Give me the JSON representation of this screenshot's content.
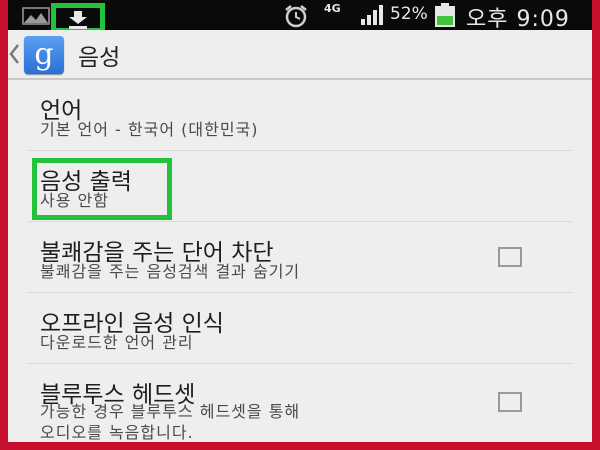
{
  "status_bar": {
    "network": "4G",
    "battery": "52%",
    "time": "오후 9:09",
    "icons": [
      "picture-icon",
      "download-icon",
      "alarm-icon",
      "signal-icon",
      "battery-icon"
    ]
  },
  "action_bar": {
    "back_icon": "chevron-left-icon",
    "app_icon_letter": "g",
    "title": "음성"
  },
  "settings": [
    {
      "title": "언어",
      "subtitle": "기본 언어 - 한국어 (대한민국)"
    },
    {
      "title": "음성 출력",
      "subtitle": "사용 안함"
    },
    {
      "title": "불쾌감을 주는 단어 차단",
      "subtitle": "불쾌감을 주는 음성검색 결과 숨기기",
      "checked": false
    },
    {
      "title": "오프라인 음성 인식",
      "subtitle": "다운로드한 언어 관리"
    },
    {
      "title": "블루투스 헤드셋",
      "subtitle_lines": [
        "가능한 경우 블루투스 헤드셋을 통해",
        "오디오를 녹음합니다."
      ],
      "checked": false
    }
  ],
  "colors": {
    "frame": "#c8102e",
    "highlight": "#22c33a",
    "status_bar": "#0a0a0a",
    "background": "#eeeeee"
  }
}
